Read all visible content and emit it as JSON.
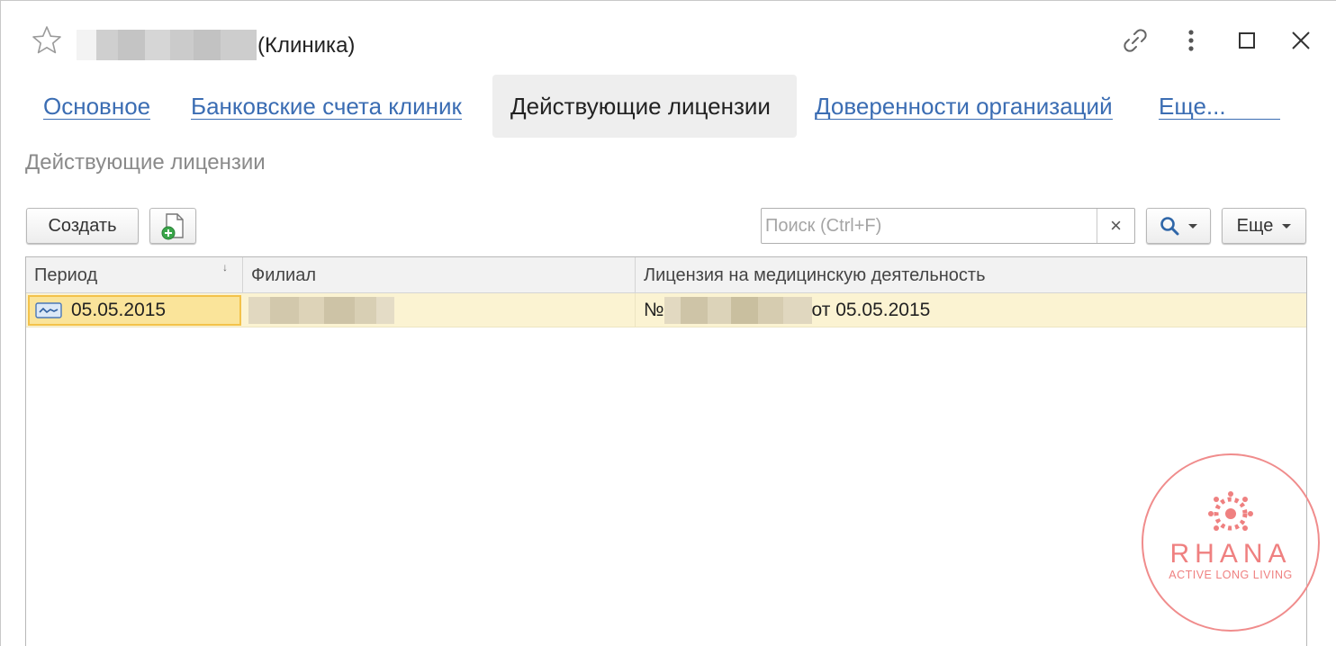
{
  "window": {
    "title_suffix": "(Клиника)"
  },
  "titlebar_icons": [
    "star-icon",
    "link-icon",
    "more-vertical-icon",
    "maximize-icon",
    "close-icon"
  ],
  "tabs": [
    {
      "label": "Основное",
      "active": false
    },
    {
      "label": "Банковские счета клиник",
      "active": false
    },
    {
      "label": "Действующие лицензии",
      "active": true
    },
    {
      "label": "Доверенности организаций",
      "active": false
    }
  ],
  "tabs_more_label": "Еще...",
  "section_title": "Действующие лицензии",
  "toolbar": {
    "create_label": "Создать",
    "search_placeholder": "Поиск (Ctrl+F)",
    "search_clear": "×",
    "more_label": "Еще"
  },
  "table": {
    "columns": [
      "Период",
      "Филиал",
      "Лицензия на медицинскую деятельность"
    ],
    "sort_indicator": "↓",
    "rows": [
      {
        "period": "05.05.2015",
        "license_prefix": "№",
        "license_suffix": "от 05.05.2015"
      }
    ]
  },
  "watermark": {
    "brand": "RHANA",
    "tagline": "ACTIVE LONG LIVING",
    "color": "#f08c8c"
  },
  "colors": {
    "link": "#3b6db3",
    "selected_row": "#fbf3d2",
    "selected_cell": "#fae49a"
  }
}
